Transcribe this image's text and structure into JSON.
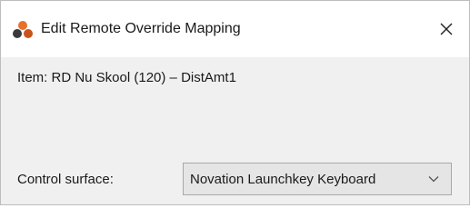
{
  "window": {
    "title": "Edit Remote Override Mapping",
    "icon": "app-logo-icon",
    "close_icon": "close-icon"
  },
  "content": {
    "item_text": "Item: RD Nu Skool (120) – DistAmt1",
    "control_surface_label": "Control surface:",
    "control_surface_value": "Novation Launchkey Keyboard"
  },
  "colors": {
    "logo_orange": "#e8702a",
    "logo_dark": "#3a3a3a",
    "dialog_bg": "#f0f0f0",
    "titlebar_bg": "#ffffff"
  }
}
